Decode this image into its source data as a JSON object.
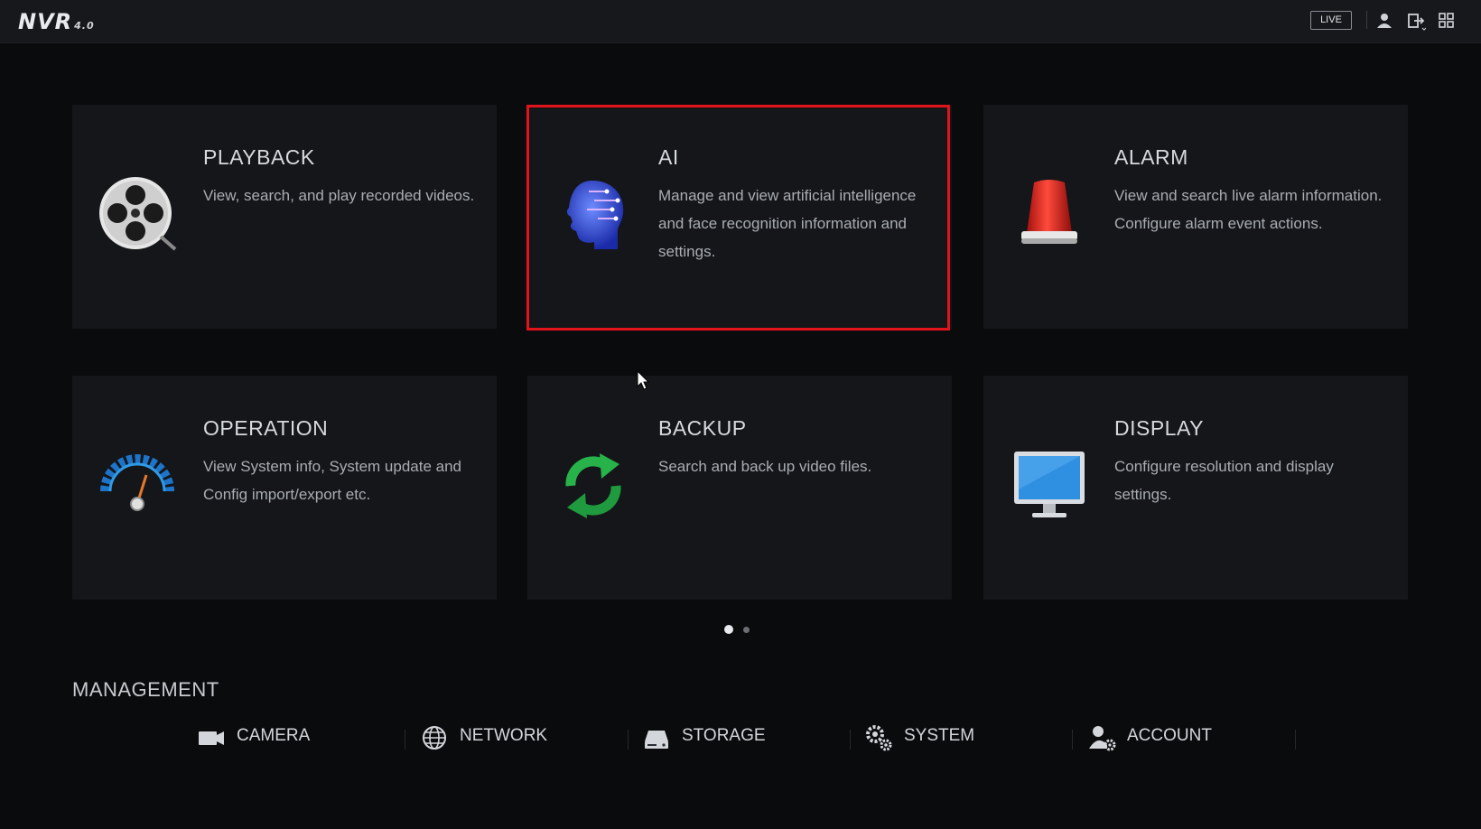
{
  "header": {
    "logo_text": "NVR",
    "logo_version": "4.0",
    "live_label": "LIVE",
    "icons": [
      "user-icon",
      "logout-icon",
      "grid-icon"
    ]
  },
  "tiles": [
    {
      "title": "PLAYBACK",
      "description": "View, search, and play recorded videos.",
      "icon": "film-reel-icon"
    },
    {
      "title": "AI",
      "description": "Manage and view artificial intelligence and face recognition information and settings.",
      "icon": "ai-head-icon"
    },
    {
      "title": "ALARM",
      "description": "View and search live alarm information. Configure alarm event actions.",
      "icon": "alarm-light-icon"
    },
    {
      "title": "OPERATION",
      "description": "View System info, System update and Config import/export etc.",
      "icon": "gauge-icon"
    },
    {
      "title": "BACKUP",
      "description": "Search and back up video files.",
      "icon": "sync-arrows-icon"
    },
    {
      "title": "DISPLAY",
      "description": "Configure resolution and display settings.",
      "icon": "monitor-icon"
    }
  ],
  "pagination": {
    "current_page": 1,
    "total_pages": 2
  },
  "management": {
    "title": "MANAGEMENT",
    "items": [
      {
        "label": "CAMERA",
        "icon": "camera-icon"
      },
      {
        "label": "NETWORK",
        "icon": "network-globe-icon"
      },
      {
        "label": "STORAGE",
        "icon": "hard-drive-icon"
      },
      {
        "label": "SYSTEM",
        "icon": "gears-icon"
      },
      {
        "label": "ACCOUNT",
        "icon": "user-gear-icon"
      }
    ]
  },
  "colors": {
    "background": "#0a0b0d",
    "tile_background": "#141619",
    "highlight": "#e3131b",
    "text": "#d6d9dd"
  }
}
